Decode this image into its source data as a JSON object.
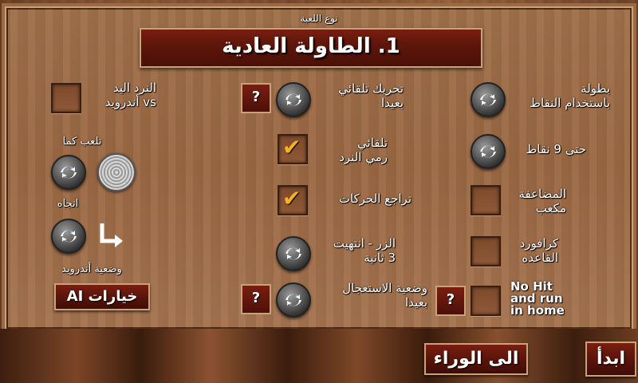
{
  "header": {
    "game_type_label": "نوع اللعبة",
    "title": "1. الطاولة العادية"
  },
  "left": {
    "dice_hand_label": "النرد اليد\nvs أندرويد",
    "play_as_label": "تلعب كما",
    "direction_label": "اتجاه",
    "android_mode_label": "وضعية أندرويد",
    "ai_options_button": "خيارات AI"
  },
  "middle": {
    "auto_move_label": "تحريك تلقائي\nبعيدا",
    "auto_roll_label": "تلقائي\nرمي النرد",
    "undo_moves_label": "تراجع الحركات",
    "done_button_label": "الزر - انتهيت\n3 ثانية",
    "hurry_mode_label": "وضعية الاستعجال\nبعيدا",
    "help_symbol": "?"
  },
  "right": {
    "tournament_label": "بطولة\nباستخدام النقاط",
    "until_points_label": "حتى 9 نقاط",
    "doubling_cube_label": "المضاعفة\nمكعب",
    "crawford_label": "كرافورد\nالقاعده",
    "no_hit_label": "No Hit\nand run\nin home"
  },
  "footer": {
    "back_button": "الى الوراء",
    "start_button": "ابدأ"
  },
  "state": {
    "auto_roll_checked": true,
    "undo_moves_checked": true,
    "dice_hand_checked": false,
    "doubling_cube_checked": false,
    "crawford_checked": false,
    "no_hit_checked": false
  },
  "colors": {
    "accent_red": "#5e160b",
    "check_gold": "#f6b321",
    "wood": "#9b6843"
  }
}
